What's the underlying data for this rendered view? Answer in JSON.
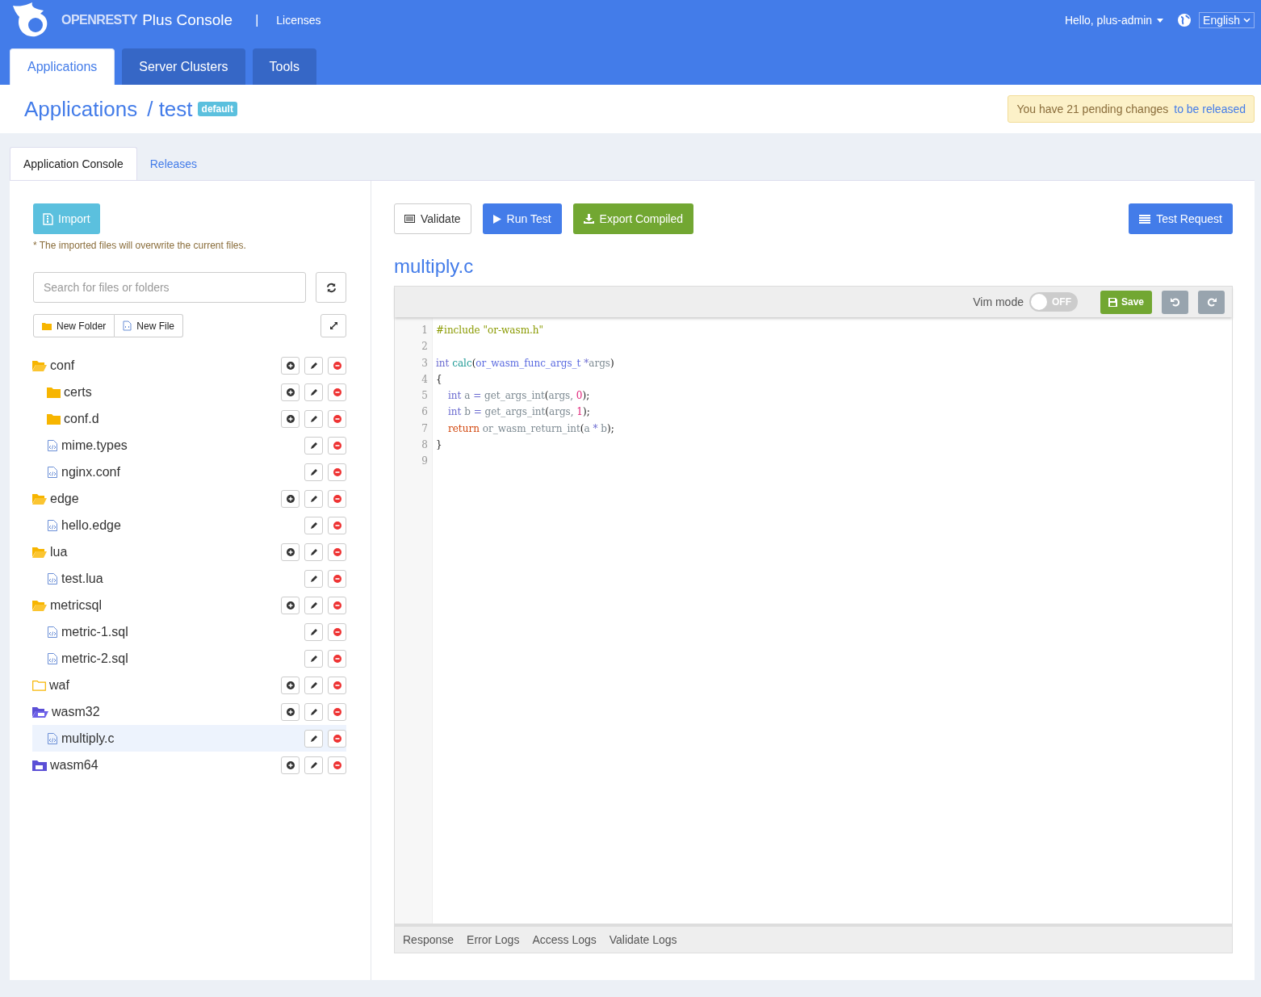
{
  "header": {
    "brand": "OPENRESTY",
    "product": "Plus Console",
    "separator": "|",
    "link": "Licenses",
    "user": "Hello, plus-admin",
    "language": "English"
  },
  "nav_tabs": [
    {
      "label": "Applications",
      "selected": true
    },
    {
      "label": "Server Clusters",
      "selected": false
    },
    {
      "label": "Tools",
      "selected": false
    }
  ],
  "breadcrumb": {
    "root": "Applications",
    "current": "/ test",
    "badge": "default"
  },
  "pending_notice": {
    "text": "You have 21 pending changes",
    "link": "to be released"
  },
  "page_tabs": [
    {
      "label": "Application Console",
      "selected": true
    },
    {
      "label": "Releases",
      "selected": false
    }
  ],
  "sidebar": {
    "import_button": "Import",
    "import_note": "* The imported files will overwrite the current files.",
    "search": {
      "placeholder": "Search for files or folders"
    },
    "new_folder": "New Folder",
    "new_file": "New File",
    "tree": [
      {
        "name": "conf",
        "kind": "folder",
        "expanded": true,
        "selected": false,
        "children": [
          {
            "name": "certs",
            "kind": "folder",
            "expanded": false,
            "selected": false
          },
          {
            "name": "conf.d",
            "kind": "folder",
            "expanded": false,
            "selected": false
          },
          {
            "name": "mime.types",
            "kind": "file",
            "selected": false
          },
          {
            "name": "nginx.conf",
            "kind": "file",
            "selected": false
          }
        ]
      },
      {
        "name": "edge",
        "kind": "folder",
        "expanded": true,
        "selected": false,
        "children": [
          {
            "name": "hello.edge",
            "kind": "file",
            "selected": false
          }
        ]
      },
      {
        "name": "lua",
        "kind": "folder",
        "expanded": true,
        "selected": false,
        "children": [
          {
            "name": "test.lua",
            "kind": "file",
            "selected": false
          }
        ]
      },
      {
        "name": "metricsql",
        "kind": "folder",
        "expanded": true,
        "selected": false,
        "children": [
          {
            "name": "metric-1.sql",
            "kind": "file",
            "selected": false
          },
          {
            "name": "metric-2.sql",
            "kind": "file",
            "selected": false
          }
        ]
      },
      {
        "name": "waf",
        "kind": "folder",
        "expanded": false,
        "empty": true,
        "selected": false
      },
      {
        "name": "wasm32",
        "kind": "wasm-folder",
        "expanded": true,
        "selected": false,
        "children": [
          {
            "name": "multiply.c",
            "kind": "file",
            "selected": true
          }
        ]
      },
      {
        "name": "wasm64",
        "kind": "wasm-folder",
        "expanded": false,
        "selected": false
      }
    ]
  },
  "toolbar": {
    "validate": "Validate",
    "run_test": "Run Test",
    "export": "Export Compiled",
    "test_request": "Test Request"
  },
  "editor": {
    "filename": "multiply.c",
    "vim_label": "Vim mode",
    "vim_mode": {
      "on": false,
      "label": "OFF"
    },
    "save": "Save",
    "lines": [
      {
        "number": "1",
        "indented": false,
        "tokens": [
          {
            "kind": "meta",
            "text": "#include \"or-wasm.h\""
          }
        ]
      },
      {
        "number": "2"
      },
      {
        "number": "3",
        "indented": false,
        "tokens": [
          {
            "kind": "keyword",
            "text": "int"
          },
          {
            "kind": "def",
            "text": " calc"
          },
          {
            "kind": "punct",
            "text": "("
          },
          {
            "kind": "type",
            "text": "or_wasm_func_args_t "
          },
          {
            "kind": "op",
            "text": "*"
          },
          {
            "kind": "plain",
            "text": "args"
          },
          {
            "kind": "punct",
            "text": ")"
          }
        ]
      },
      {
        "number": "4",
        "indented": false,
        "tokens": [
          {
            "kind": "punct",
            "text": "{"
          }
        ]
      },
      {
        "number": "5",
        "indented": true,
        "tokens": [
          {
            "kind": "keyword",
            "text": "int"
          },
          {
            "kind": "plain",
            "text": " a "
          },
          {
            "kind": "op",
            "text": "="
          },
          {
            "kind": "plain",
            "text": " get_args_int"
          },
          {
            "kind": "punct",
            "text": "("
          },
          {
            "kind": "plain",
            "text": "args, "
          },
          {
            "kind": "number",
            "text": "0"
          },
          {
            "kind": "punct",
            "text": ");"
          }
        ]
      },
      {
        "number": "6",
        "indented": true,
        "tokens": [
          {
            "kind": "keyword",
            "text": "int"
          },
          {
            "kind": "plain",
            "text": " b "
          },
          {
            "kind": "op",
            "text": "="
          },
          {
            "kind": "plain",
            "text": " get_args_int"
          },
          {
            "kind": "punct",
            "text": "("
          },
          {
            "kind": "plain",
            "text": "args, "
          },
          {
            "kind": "number",
            "text": "1"
          },
          {
            "kind": "punct",
            "text": ");"
          }
        ]
      },
      {
        "number": "7",
        "indented": true,
        "tokens": [
          {
            "kind": "control",
            "text": "return"
          },
          {
            "kind": "plain",
            "text": " or_wasm_return_int"
          },
          {
            "kind": "punct",
            "text": "("
          },
          {
            "kind": "plain",
            "text": "a "
          },
          {
            "kind": "op",
            "text": "*"
          },
          {
            "kind": "plain",
            "text": " b"
          },
          {
            "kind": "punct",
            "text": ");"
          }
        ]
      },
      {
        "number": "8",
        "indented": false,
        "tokens": [
          {
            "kind": "punct",
            "text": "}"
          }
        ]
      },
      {
        "number": "9"
      }
    ],
    "log_tabs": [
      "Response",
      "Error Logs",
      "Access Logs",
      "Validate Logs"
    ]
  }
}
